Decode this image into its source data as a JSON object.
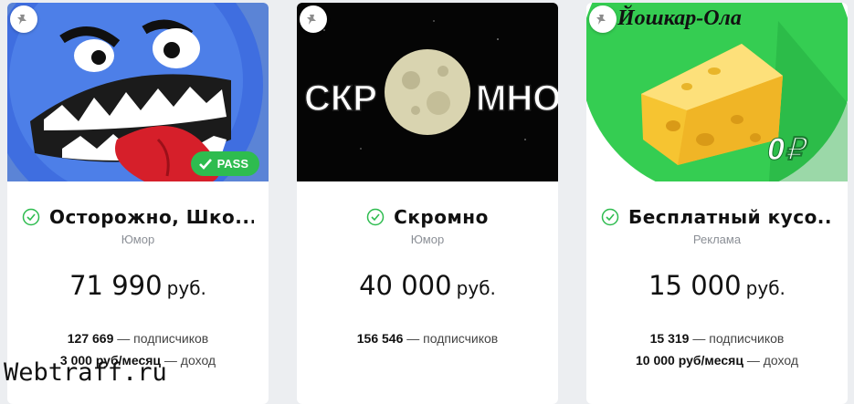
{
  "watermark": "Webtraff.ru",
  "cards": [
    {
      "title": "Осторожно, Шко...",
      "category": "Юмор",
      "price_value": "71 990",
      "price_currency": "руб.",
      "subscribers_value": "127 669",
      "subscribers_label": "— подписчиков",
      "income_value": "3 000 руб/месяц",
      "income_label": "— доход",
      "badge": "PASS"
    },
    {
      "title": "Скромно",
      "category": "Юмор",
      "price_value": "40 000",
      "price_currency": "руб.",
      "subscribers_value": "156 546",
      "subscribers_label": "— подписчиков",
      "image_text_left": "СКР",
      "image_text_right": "МНО"
    },
    {
      "title": "Бесплатный кусо...",
      "category": "Реклама",
      "price_value": "15 000",
      "price_currency": "руб.",
      "subscribers_value": "15 319",
      "subscribers_label": "— подписчиков",
      "income_value": "10 000 руб/месяц",
      "income_label": "— доход",
      "image_title": "Йошкар-Ола",
      "image_price": "0₽"
    }
  ]
}
